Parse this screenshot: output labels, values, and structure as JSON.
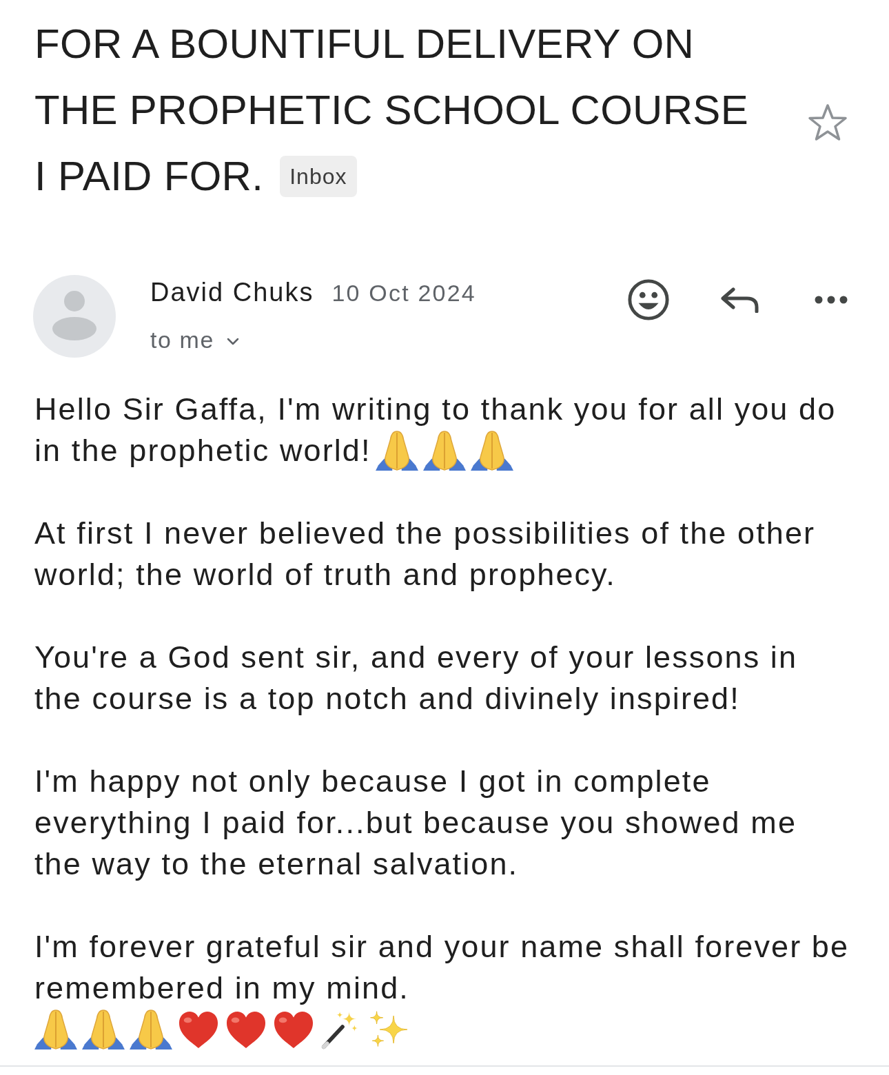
{
  "subject": {
    "title": "FOR A BOUNTIFUL DELIVERY ON THE PROPHETIC SCHOOL COURSE I PAID FOR.",
    "label": "Inbox",
    "starred": false
  },
  "message": {
    "sender": "David Chuks",
    "date": "10 Oct 2024",
    "recipient": "to me"
  },
  "body": [
    {
      "lines": [
        {
          "text": "Hello Sir Gaffa, I'm writing to thank you for all you do in the prophetic world!",
          "emojis": [
            {
              "kind": "praying-hands"
            },
            {
              "kind": "praying-hands"
            },
            {
              "kind": "praying-hands"
            }
          ]
        }
      ]
    },
    {
      "lines": [
        {
          "text": "At first I never believed the possibilities of the other world; the world of truth and prophecy."
        }
      ]
    },
    {
      "lines": [
        {
          "text": "You're a God sent sir, and every of your lessons in the course is a top notch and divinely inspired!"
        }
      ]
    },
    {
      "lines": [
        {
          "text": "I'm happy not only because I got in complete everything I paid for...but because you showed me the way to the eternal salvation."
        }
      ]
    },
    {
      "lines": [
        {
          "text": "I'm forever grateful sir and your name shall forever be remembered in my mind."
        },
        {
          "emojis": [
            {
              "kind": "praying-hands"
            },
            {
              "kind": "praying-hands"
            },
            {
              "kind": "praying-hands"
            },
            {
              "kind": "heart"
            },
            {
              "kind": "heart"
            },
            {
              "kind": "heart"
            },
            {
              "kind": "magic-wand"
            },
            {
              "kind": "sparkles"
            }
          ]
        }
      ]
    }
  ]
}
